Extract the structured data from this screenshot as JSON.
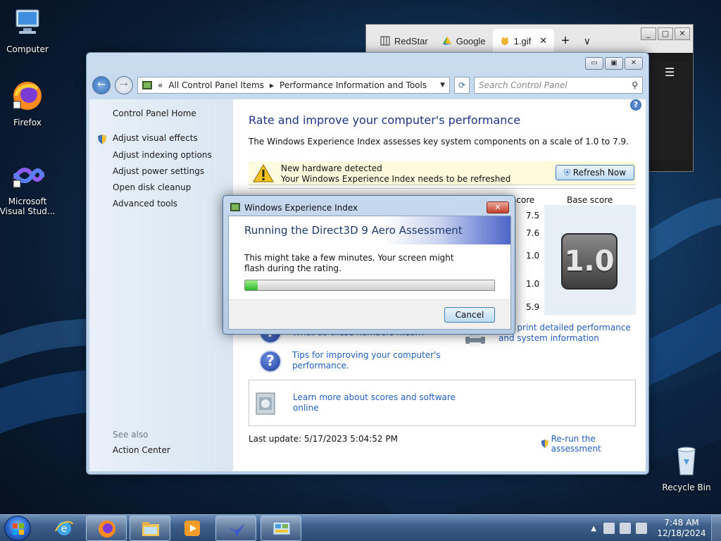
{
  "desktop": {
    "icons": [
      {
        "label": "Computer"
      },
      {
        "label": "Firefox"
      },
      {
        "label": "Microsoft Visual Stud..."
      },
      {
        "label": "Recycle Bin"
      }
    ]
  },
  "browser": {
    "tabs": [
      {
        "label": "RedStar"
      },
      {
        "label": "Google"
      },
      {
        "label": "1.gif"
      }
    ],
    "new_tab": "+",
    "tab_list": "∨",
    "close_tab": "✕",
    "menu": "☰"
  },
  "control_panel": {
    "breadcrumb_prefix": "«",
    "breadcrumb": [
      "All Control Panel Items",
      "Performance Information and Tools"
    ],
    "search_placeholder": "Search Control Panel",
    "sidebar": {
      "home": "Control Panel Home",
      "items": [
        {
          "label": "Adjust visual effects"
        },
        {
          "label": "Adjust indexing options"
        },
        {
          "label": "Adjust power settings"
        },
        {
          "label": "Open disk cleanup"
        },
        {
          "label": "Advanced tools"
        }
      ],
      "see_also": "See also",
      "action_center": "Action Center"
    },
    "main": {
      "title": "Rate and improve your computer's performance",
      "description": "The Windows Experience Index assesses key system components on a scale of 1.0 to 7.9.",
      "notice_line1": "New hardware detected",
      "notice_line2": "Your Windows Experience Index needs to be refreshed",
      "refresh_button": "Refresh Now",
      "col_subscore": "score",
      "col_basescore": "Base score",
      "subscores": [
        "7.5",
        "7.6",
        "1.0",
        "1.0",
        "5.9"
      ],
      "base_score": "1.0",
      "link_numbers": "What do these numbers mean?",
      "link_print_1": "and print detailed performance",
      "link_print_2": "and system information",
      "link_tips_1": "Tips for improving your computer's",
      "link_tips_2": "performance.",
      "link_learn_1": "Learn more about scores and software",
      "link_learn_2": "online",
      "last_update": "Last update: 5/17/2023 5:04:52 PM",
      "rerun": "Re-run the assessment"
    }
  },
  "wei_dialog": {
    "title": "Windows Experience Index",
    "header": "Running the Direct3D 9 Aero Assessment",
    "message": "This might take a few minutes. Your screen might flash during the rating.",
    "progress": 0.05,
    "cancel": "Cancel"
  },
  "taskbar": {
    "clock_time": "7:48 AM",
    "clock_date": "12/18/2024"
  },
  "colors": {
    "link": "#1f5fc4",
    "title_blue": "#1e3287",
    "progress_green": "#2cb72c"
  }
}
